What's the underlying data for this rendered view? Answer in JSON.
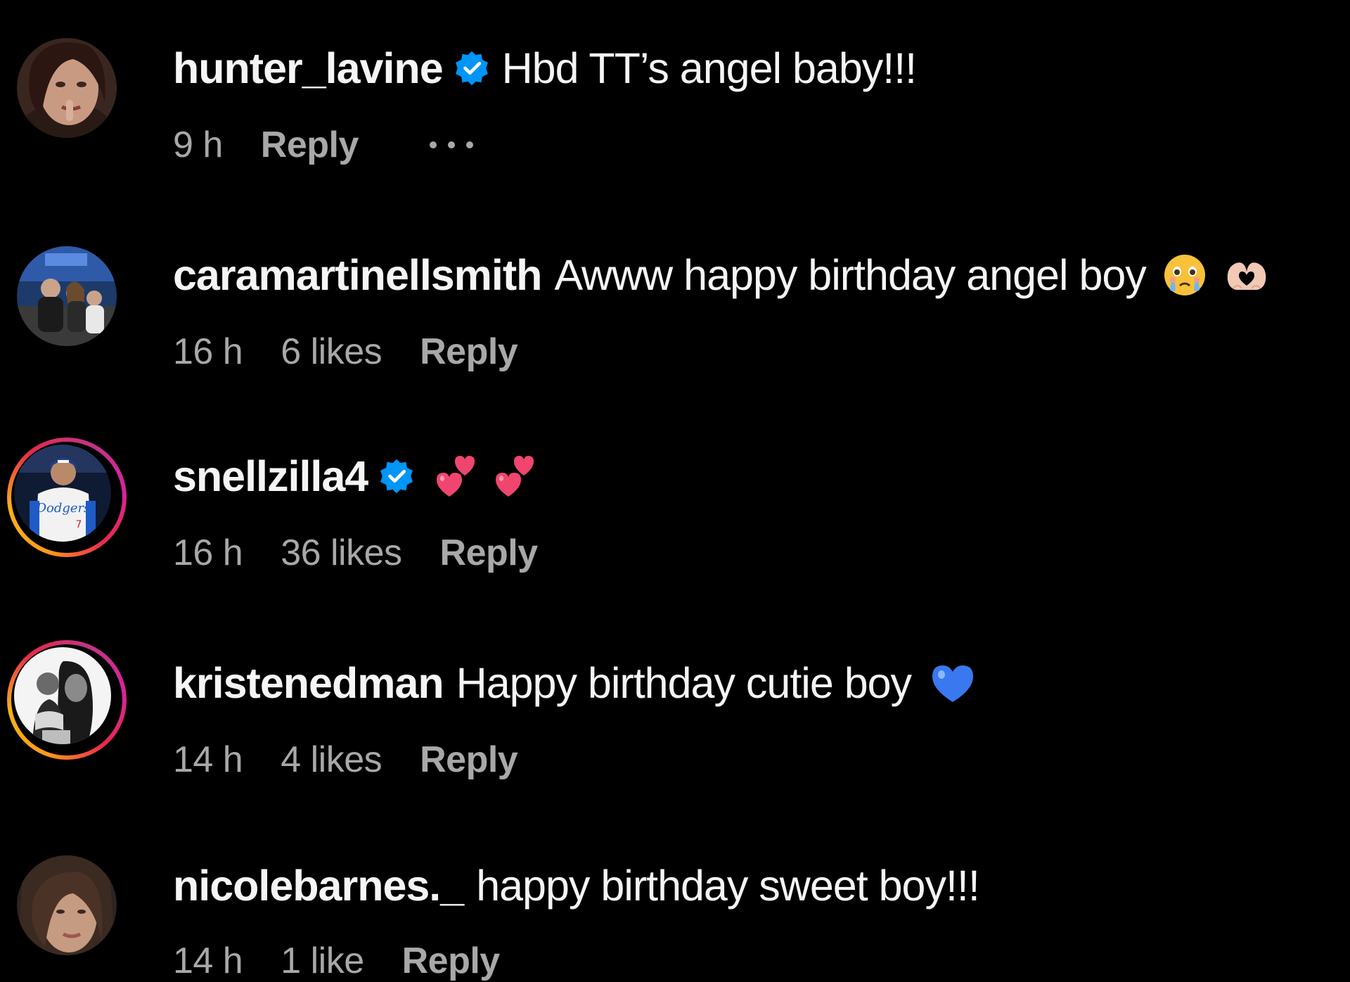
{
  "comments": [
    {
      "username": "hunter_lavine",
      "verified": true,
      "text": "Hbd TT’s angel baby!!!",
      "emojis": [],
      "time": "9 h",
      "likes": "",
      "reply_label": "Reply",
      "show_more": true,
      "story_ring": false
    },
    {
      "username": "caramartinellsmith",
      "verified": false,
      "text": "Awww happy birthday angel boy",
      "emojis": [
        "crying-face-emoji",
        "heart-hands-emoji"
      ],
      "time": "16 h",
      "likes": "6 likes",
      "reply_label": "Reply",
      "show_more": false,
      "story_ring": false
    },
    {
      "username": "snellzilla4",
      "verified": true,
      "text": "",
      "emojis": [
        "two-hearts-emoji",
        "two-hearts-emoji"
      ],
      "time": "16 h",
      "likes": "36 likes",
      "reply_label": "Reply",
      "show_more": false,
      "story_ring": true
    },
    {
      "username": "kristenedman",
      "verified": false,
      "text": "Happy birthday cutie boy",
      "emojis": [
        "blue-heart-emoji"
      ],
      "time": "14 h",
      "likes": "4 likes",
      "reply_label": "Reply",
      "show_more": false,
      "story_ring": true
    },
    {
      "username": "nicolebarnes._",
      "verified": false,
      "text": "happy birthday sweet boy!!!",
      "emojis": [],
      "time": "14 h",
      "likes": "1 like",
      "reply_label": "Reply",
      "show_more": false,
      "story_ring": false
    }
  ],
  "colors": {
    "background": "#000000",
    "primary_text": "#f5f5f5",
    "secondary_text": "#a8a8a8",
    "verified_blue": "#0095f6"
  }
}
